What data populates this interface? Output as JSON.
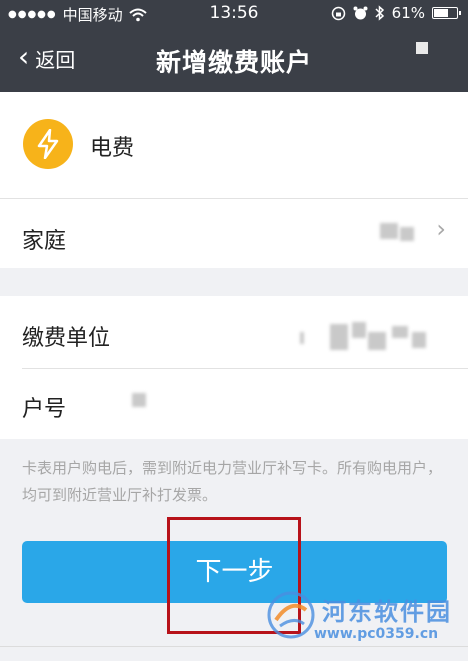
{
  "status_bar": {
    "carrier": "中国移动",
    "time": "13:56",
    "battery": "61%",
    "icons": [
      "signal-dots-icon",
      "wifi-icon",
      "rotation-lock-icon",
      "alarm-icon",
      "bluetooth-icon",
      "battery-icon"
    ]
  },
  "nav": {
    "back_label": "返回",
    "title": "新增缴费账户"
  },
  "bill": {
    "name": "电费",
    "icon": "lightning-icon",
    "icon_color": "#f7b31a"
  },
  "group": {
    "label": "家庭"
  },
  "form": {
    "payee_label": "缴费单位",
    "account_label": "户号"
  },
  "hint": "卡表用户购电后，需到附近电力营业厅补写卡。所有购电用户，均可到附近营业厅补打发票。",
  "next_button": {
    "label": "下一步",
    "color": "#2aa7e8"
  },
  "watermark": {
    "name": "河东软件园",
    "url": "www.pc0359.cn"
  },
  "colors": {
    "header_bg": "#3b3f47",
    "highlight_box": "#b7121a"
  }
}
